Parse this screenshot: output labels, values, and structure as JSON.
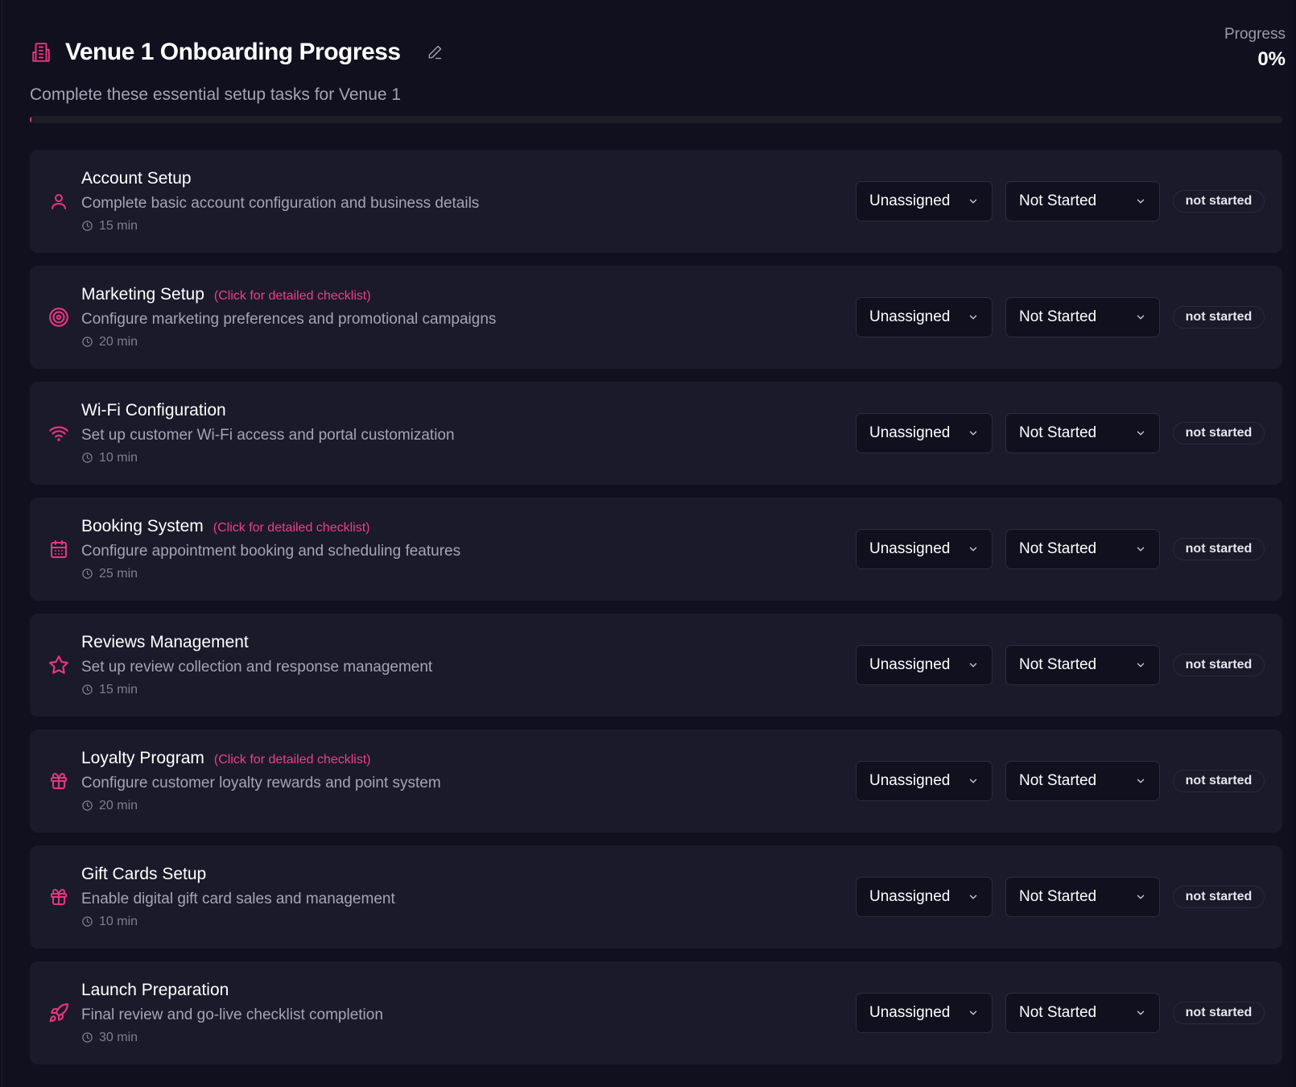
{
  "header": {
    "title": "Venue 1 Onboarding Progress",
    "subtitle": "Complete these essential setup tasks for Venue 1",
    "progress_label": "Progress",
    "progress_value": "0%",
    "progress_fraction": 0
  },
  "colors": {
    "accent": "#e8357e",
    "background": "#10101f",
    "card": "#1a1a2a"
  },
  "tasks": [
    {
      "icon": "user-icon",
      "title": "Account Setup",
      "checklist_link": "",
      "description": "Complete basic account configuration and business details",
      "time": "15 min",
      "assignee": "Unassigned",
      "status_select": "Not Started",
      "status_badge": "not started"
    },
    {
      "icon": "target-icon",
      "title": "Marketing Setup",
      "checklist_link": "(Click for detailed checklist)",
      "description": "Configure marketing preferences and promotional campaigns",
      "time": "20 min",
      "assignee": "Unassigned",
      "status_select": "Not Started",
      "status_badge": "not started"
    },
    {
      "icon": "wifi-icon",
      "title": "Wi-Fi Configuration",
      "checklist_link": "",
      "description": "Set up customer Wi-Fi access and portal customization",
      "time": "10 min",
      "assignee": "Unassigned",
      "status_select": "Not Started",
      "status_badge": "not started"
    },
    {
      "icon": "calendar-icon",
      "title": "Booking System",
      "checklist_link": "(Click for detailed checklist)",
      "description": "Configure appointment booking and scheduling features",
      "time": "25 min",
      "assignee": "Unassigned",
      "status_select": "Not Started",
      "status_badge": "not started"
    },
    {
      "icon": "star-icon",
      "title": "Reviews Management",
      "checklist_link": "",
      "description": "Set up review collection and response management",
      "time": "15 min",
      "assignee": "Unassigned",
      "status_select": "Not Started",
      "status_badge": "not started"
    },
    {
      "icon": "gift-icon",
      "title": "Loyalty Program",
      "checklist_link": "(Click for detailed checklist)",
      "description": "Configure customer loyalty rewards and point system",
      "time": "20 min",
      "assignee": "Unassigned",
      "status_select": "Not Started",
      "status_badge": "not started"
    },
    {
      "icon": "gift-icon",
      "title": "Gift Cards Setup",
      "checklist_link": "",
      "description": "Enable digital gift card sales and management",
      "time": "10 min",
      "assignee": "Unassigned",
      "status_select": "Not Started",
      "status_badge": "not started"
    },
    {
      "icon": "rocket-icon",
      "title": "Launch Preparation",
      "checklist_link": "",
      "description": "Final review and go-live checklist completion",
      "time": "30 min",
      "assignee": "Unassigned",
      "status_select": "Not Started",
      "status_badge": "not started"
    }
  ]
}
